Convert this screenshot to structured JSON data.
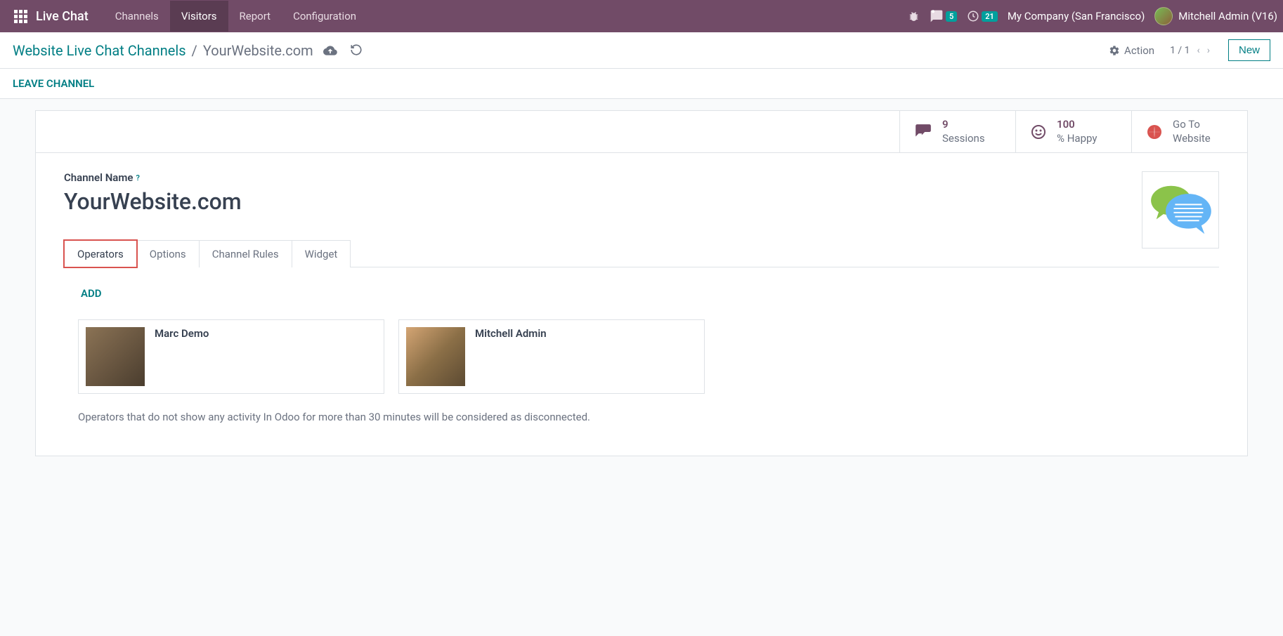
{
  "navbar": {
    "brand": "Live Chat",
    "menu": [
      {
        "label": "Channels"
      },
      {
        "label": "Visitors"
      },
      {
        "label": "Report"
      },
      {
        "label": "Configuration"
      }
    ],
    "active_menu_index": 1,
    "messages_badge": "5",
    "activities_badge": "21",
    "company": "My Company (San Francisco)",
    "user": "Mitchell Admin (V16)"
  },
  "breadcrumb": {
    "parent": "Website Live Chat Channels",
    "current": "YourWebsite.com"
  },
  "controls": {
    "action_label": "Action",
    "pager": "1 / 1",
    "new_label": "New"
  },
  "statusbar": {
    "leave_label": "LEAVE CHANNEL"
  },
  "stats": {
    "sessions": {
      "value": "9",
      "label": "Sessions"
    },
    "happy": {
      "value": "100",
      "label": "% Happy"
    },
    "goto": {
      "line1": "Go To",
      "line2": "Website"
    }
  },
  "form": {
    "channel_name_label": "Channel Name",
    "channel_name_help": "?",
    "channel_name_value": "YourWebsite.com"
  },
  "tabs": [
    {
      "label": "Operators"
    },
    {
      "label": "Options"
    },
    {
      "label": "Channel Rules"
    },
    {
      "label": "Widget"
    }
  ],
  "active_tab_index": 0,
  "operators_tab": {
    "add_label": "ADD",
    "items": [
      {
        "name": "Marc Demo"
      },
      {
        "name": "Mitchell Admin"
      }
    ],
    "footer_text": "Operators that do not show any activity In Odoo for more than 30 minutes will be considered as disconnected."
  }
}
